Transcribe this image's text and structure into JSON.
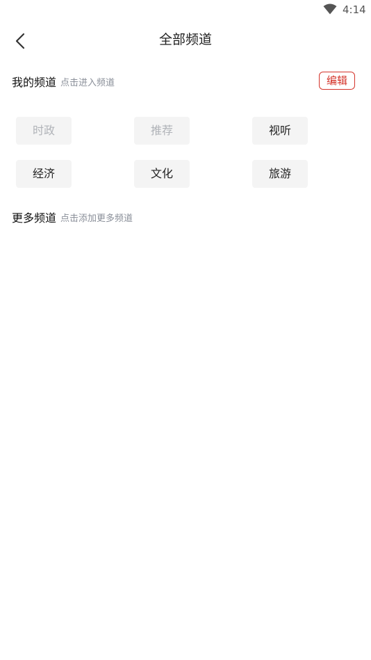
{
  "status_bar": {
    "time": "4:14"
  },
  "header": {
    "title": "全部频道"
  },
  "my_channels": {
    "title": "我的频道",
    "hint": "点击进入频道",
    "edit_label": "编辑",
    "accent_color": "#d4332a",
    "items": [
      {
        "label": "时政",
        "disabled": true
      },
      {
        "label": "推荐",
        "disabled": true
      },
      {
        "label": "视听",
        "disabled": false
      },
      {
        "label": "经济",
        "disabled": false
      },
      {
        "label": "文化",
        "disabled": false
      },
      {
        "label": "旅游",
        "disabled": false
      }
    ]
  },
  "more_channels": {
    "title": "更多频道",
    "hint": "点击添加更多频道"
  }
}
